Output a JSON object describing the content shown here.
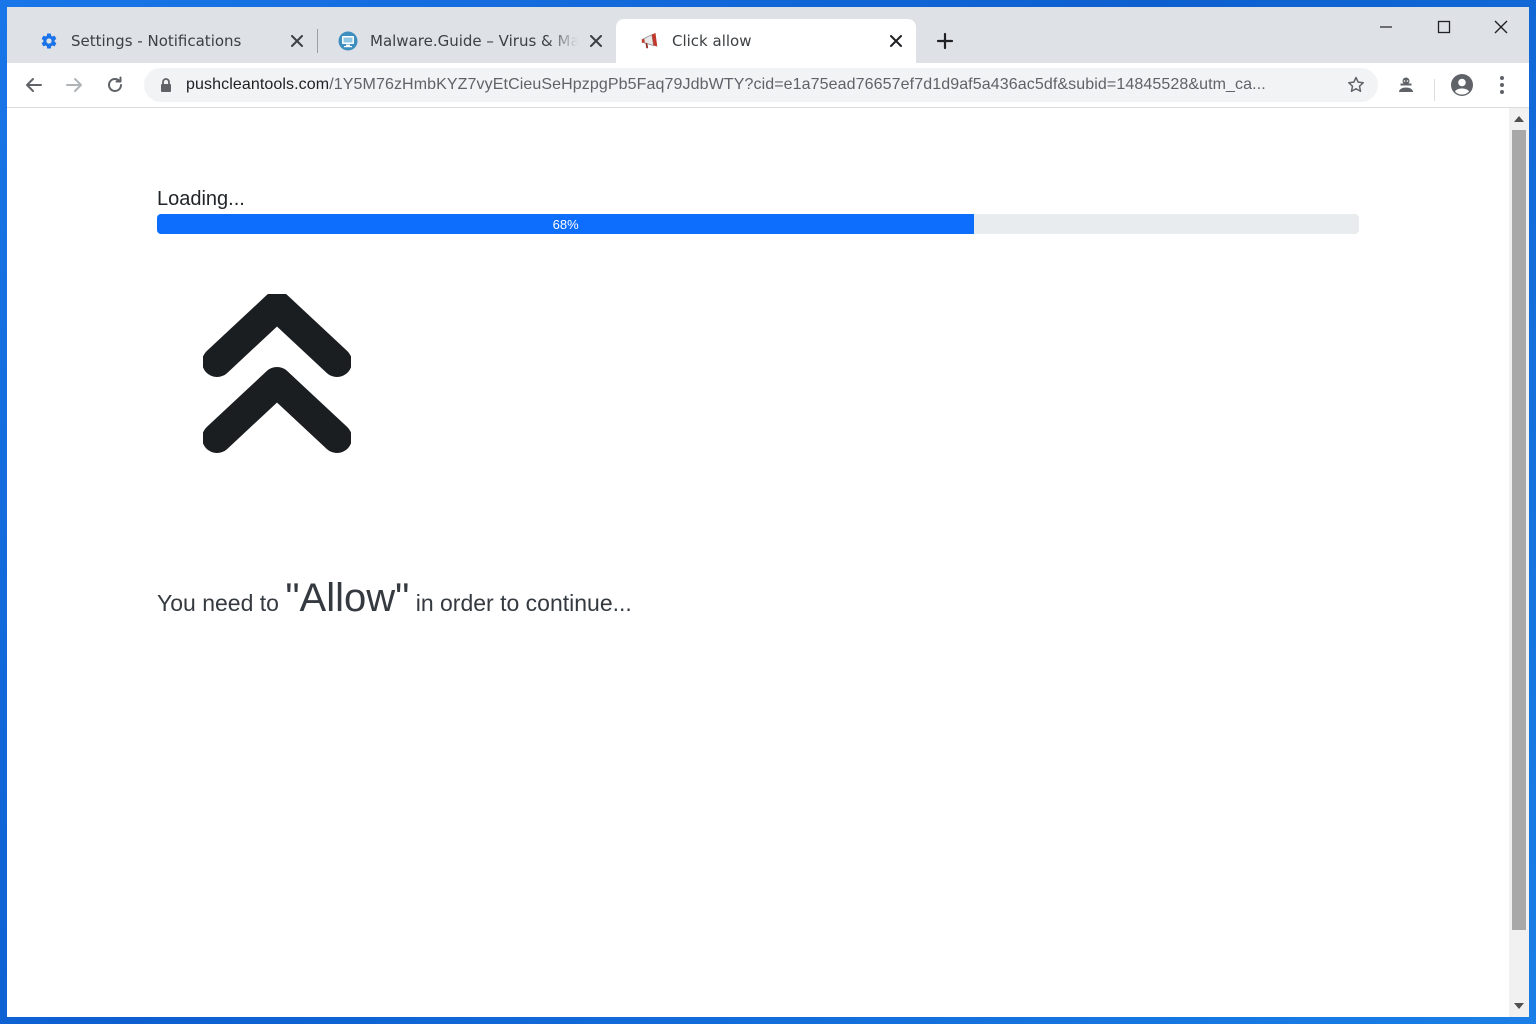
{
  "tabs": [
    {
      "title": "Settings - Notifications",
      "favicon": "gear-icon",
      "active": false
    },
    {
      "title": "Malware.Guide – Virus & Malware",
      "favicon": "monitor-icon",
      "active": false
    },
    {
      "title": "Click allow",
      "favicon": "megaphone-icon",
      "active": true
    }
  ],
  "address_bar": {
    "host": "pushcleantools.com",
    "path": "/1Y5M76zHmbKYZ7vyEtCieuSeHpzpgPb5Faq79JdbWTY?cid=e1a75ead76657ef7d1d9af5a436ac5df&subid=14845528&utm_ca..."
  },
  "page": {
    "loading_label": "Loading...",
    "progress_percent": 68,
    "progress_text": "68%",
    "message_prefix": "You need to",
    "message_highlight": "\"Allow\"",
    "message_suffix": "in order to continue..."
  },
  "colors": {
    "progress_fill": "#0d6efd",
    "progress_track": "#e9ecef",
    "tab_strip": "#dee1e6",
    "desktop": "#1976e8"
  }
}
